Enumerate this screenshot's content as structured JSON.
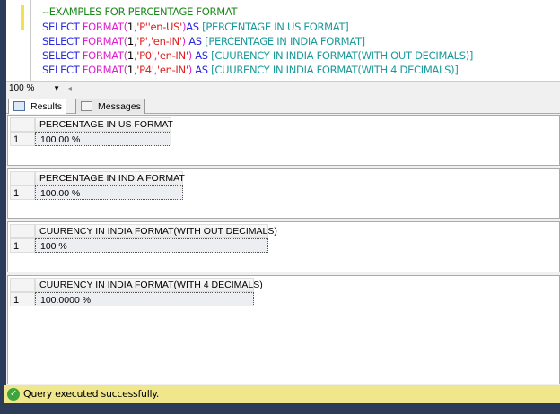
{
  "editor": {
    "comment": "--EXAMPLES FOR PERCENTAGE FORMAT",
    "lines": [
      {
        "kw": "SELECT ",
        "fn": "FORMAT(",
        "num": "1",
        "a": ",",
        "fmt": "'P'",
        ",b": ",",
        "cult": "'en-US'",
        "close": ")",
        "as": "AS ",
        "alias": "[PERCENTAGE IN US FORMAT]"
      },
      {
        "kw": "SELECT ",
        "fn": "FORMAT(",
        "num": "1",
        "a": ",",
        "fmt": "'P'",
        "b": ",",
        "cult": "'en-IN'",
        "close": ") ",
        "as": "AS ",
        "alias": "[PERCENTAGE IN INDIA FORMAT]"
      },
      {
        "kw": "SELECT ",
        "fn": "FORMAT(",
        "num": "1",
        "a": ",",
        "fmt": "'P0'",
        "b": ",",
        "cult": "'en-IN'",
        "close": ") ",
        "as": "AS ",
        "alias": "[CUURENCY IN INDIA FORMAT(WITH OUT DECIMALS)]"
      },
      {
        "kw": "SELECT ",
        "fn": "FORMAT(",
        "num": "1",
        "a": ",",
        "fmt": "'P4'",
        "b": ",",
        "cult": "'en-IN'",
        "close": ") ",
        "as": "AS ",
        "alias": "[CUURENCY IN INDIA FORMAT(WITH 4 DECIMALS)]"
      }
    ]
  },
  "zoom": "100 %",
  "tabs": [
    "Results",
    "Messages"
  ],
  "results": [
    {
      "header": "PERCENTAGE IN US FORMAT",
      "row": "1",
      "value": "100.00 %"
    },
    {
      "header": "PERCENTAGE IN INDIA FORMAT",
      "row": "1",
      "value": "100.00 %"
    },
    {
      "header": "CUURENCY IN INDIA FORMAT(WITH OUT DECIMALS)",
      "row": "1",
      "value": "100 %"
    },
    {
      "header": "CUURENCY IN INDIA FORMAT(WITH 4 DECIMALS)",
      "row": "1",
      "value": "100.0000 %"
    }
  ],
  "status": "Query executed successfully."
}
